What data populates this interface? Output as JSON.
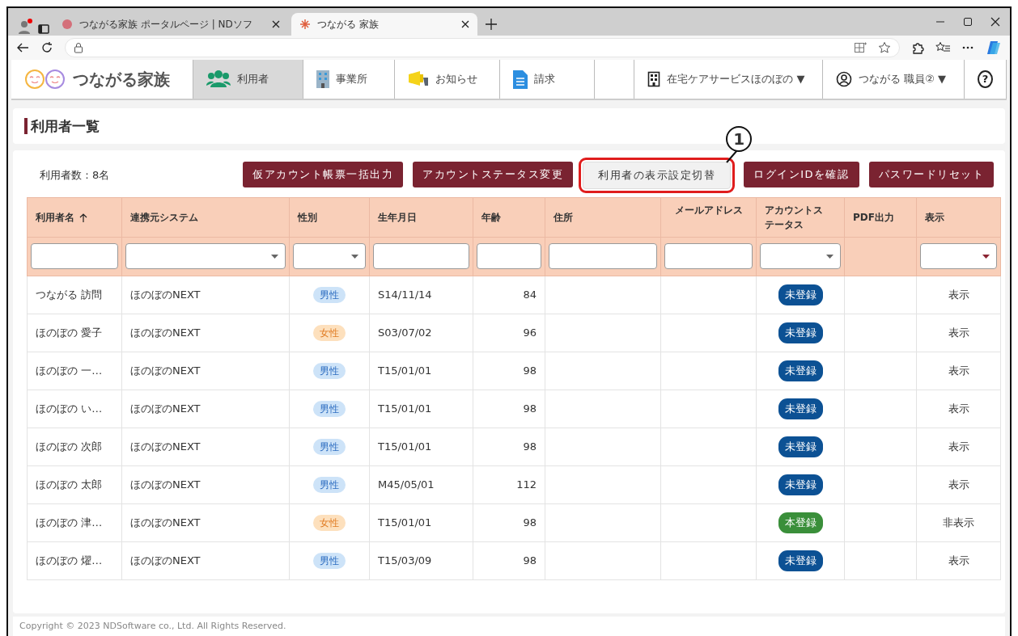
{
  "browser": {
    "tabs": [
      {
        "title": "つながる家族 ポータルページ | NDソフ",
        "selected": false
      },
      {
        "title": "つながる 家族",
        "selected": true
      }
    ]
  },
  "app": {
    "brand": "つながる家族",
    "nav": [
      {
        "label": "利用者",
        "selected": true
      },
      {
        "label": "事業所",
        "selected": false
      },
      {
        "label": "お知らせ",
        "selected": false
      },
      {
        "label": "請求",
        "selected": false
      }
    ],
    "office": "在宅ケアサービスほのぼの ▼",
    "user": "つながる 職員② ▼",
    "help": "?"
  },
  "page_title": "利用者一覧",
  "count": "利用者数：8名",
  "buttons": [
    {
      "label": "仮アカウント帳票一括出力",
      "kind": "primary",
      "highlighted": false
    },
    {
      "label": "アカウントステータス変更",
      "kind": "primary",
      "highlighted": false
    },
    {
      "label": "利用者の表示設定切替",
      "kind": "secondary",
      "highlighted": true
    },
    {
      "label": "ログインIDを確認",
      "kind": "primary",
      "highlighted": false
    },
    {
      "label": "パスワードリセット",
      "kind": "primary",
      "highlighted": false
    }
  ],
  "callout": "1",
  "table": {
    "columns": [
      {
        "label": "利用者名",
        "sorted": true,
        "kind": "text"
      },
      {
        "label": "連携元システム",
        "sorted": false,
        "kind": "select"
      },
      {
        "label": "性別",
        "sorted": false,
        "kind": "select"
      },
      {
        "label": "生年月日",
        "sorted": false,
        "kind": "text"
      },
      {
        "label": "年齢",
        "sorted": false,
        "kind": "text"
      },
      {
        "label": "住所",
        "sorted": false,
        "kind": "text"
      },
      {
        "label": "メールアドレス",
        "sorted": false,
        "kind": "text"
      },
      {
        "label": "アカウントステータス",
        "sorted": false,
        "kind": "select"
      },
      {
        "label": "PDF出力",
        "sorted": false,
        "kind": "none"
      },
      {
        "label": "表示",
        "sorted": false,
        "kind": "select"
      }
    ],
    "rows": [
      {
        "name": "つながる 訪問",
        "system": "ほのぼのNEXT",
        "gender": {
          "label": "男性",
          "kind": "male"
        },
        "birth": "S14/11/14",
        "age": "84",
        "status": {
          "label": "未登録",
          "kind": "provisional"
        },
        "display": "表示"
      },
      {
        "name": "ほのぼの 愛子",
        "system": "ほのぼのNEXT",
        "gender": {
          "label": "女性",
          "kind": "female"
        },
        "birth": "S03/07/02",
        "age": "96",
        "status": {
          "label": "未登録",
          "kind": "provisional"
        },
        "display": "表示"
      },
      {
        "name": "ほのぼの 一…",
        "system": "ほのぼのNEXT",
        "gender": {
          "label": "男性",
          "kind": "male"
        },
        "birth": "T15/01/01",
        "age": "98",
        "status": {
          "label": "未登録",
          "kind": "provisional"
        },
        "display": "表示"
      },
      {
        "name": "ほのぼの い…",
        "system": "ほのぼのNEXT",
        "gender": {
          "label": "男性",
          "kind": "male"
        },
        "birth": "T15/01/01",
        "age": "98",
        "status": {
          "label": "未登録",
          "kind": "provisional"
        },
        "display": "表示"
      },
      {
        "name": "ほのぼの 次郎",
        "system": "ほのぼのNEXT",
        "gender": {
          "label": "男性",
          "kind": "male"
        },
        "birth": "T15/01/01",
        "age": "98",
        "status": {
          "label": "未登録",
          "kind": "provisional"
        },
        "display": "表示"
      },
      {
        "name": "ほのぼの 太郎",
        "system": "ほのぼのNEXT",
        "gender": {
          "label": "男性",
          "kind": "male"
        },
        "birth": "M45/05/01",
        "age": "112",
        "status": {
          "label": "未登録",
          "kind": "provisional"
        },
        "display": "表示"
      },
      {
        "name": "ほのぼの 津…",
        "system": "ほのぼのNEXT",
        "gender": {
          "label": "女性",
          "kind": "female"
        },
        "birth": "T15/01/01",
        "age": "98",
        "status": {
          "label": "本登録",
          "kind": "registered"
        },
        "display": "非表示"
      },
      {
        "name": "ほのぼの 燿…",
        "system": "ほのぼのNEXT",
        "gender": {
          "label": "男性",
          "kind": "male"
        },
        "birth": "T15/03/09",
        "age": "98",
        "status": {
          "label": "未登録",
          "kind": "provisional"
        },
        "display": "表示"
      }
    ]
  },
  "footer": "Copyright © 2023 NDSoftware co., Ltd. All Rights Reserved."
}
